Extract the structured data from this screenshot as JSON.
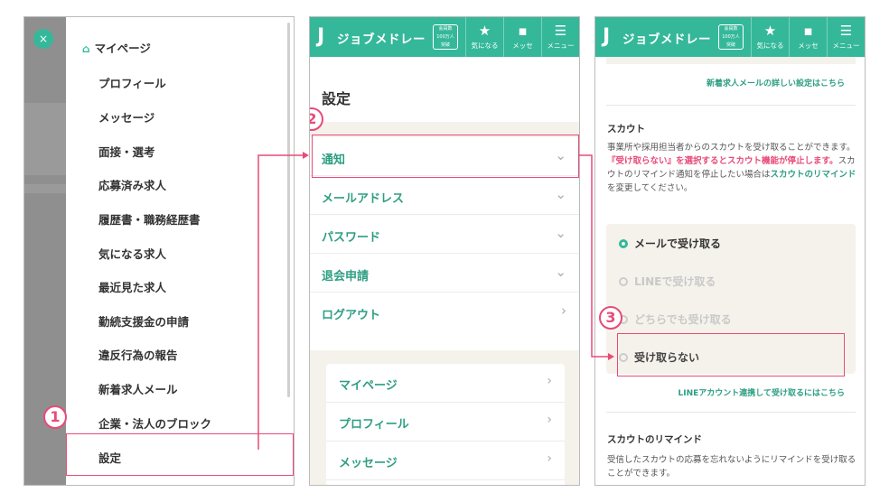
{
  "menu": {
    "close_symbol": "×",
    "home_label": "マイページ",
    "items": [
      "プロフィール",
      "メッセージ",
      "面接・選考",
      "応募済み求人",
      "履歴書・職務経歴書",
      "気になる求人",
      "最近見た求人",
      "勤続支援金の申請",
      "違反行為の報告",
      "新着求人メール",
      "企業・法人のブロック",
      "設定"
    ]
  },
  "header": {
    "logo_mark": "J",
    "logo_text": "ジョブメドレー",
    "member_badge": [
      "会員数",
      "100万人",
      "突破"
    ],
    "favorites_label": "気になる",
    "messages_label": "メッセ",
    "menu_label": "メニュー"
  },
  "settings": {
    "title": "設定",
    "items": [
      "通知",
      "メールアドレス",
      "パスワード",
      "退会申請",
      "ログアウト"
    ],
    "sub_items": [
      "マイページ",
      "プロフィール",
      "メッセージ"
    ]
  },
  "scout": {
    "new_job_mail_link": "新着求人メールの詳しい設定はこちら",
    "heading": "スカウト",
    "desc_part1": "事業所や採用担当者からのスカウトを受け取ることができます。",
    "desc_pink": "『受け取らない』を選択するとスカウト機能が停止します。",
    "desc_part2": "スカウトのリマインド通知を停止したい場合は",
    "desc_green": "スカウトのリマインド",
    "desc_part3": "を変更してください。",
    "options": [
      "メールで受け取る",
      "LINEで受け取る",
      "どちらでも受け取る",
      "受け取らない"
    ],
    "line_link": "LINEアカウント連携して受け取るにはこちら",
    "remind_heading": "スカウトのリマインド",
    "remind_desc": "受信したスカウトの応募を忘れないようにリマインドを受け取ることができます。"
  },
  "steps": [
    "1",
    "2",
    "3"
  ],
  "colors": {
    "brand": "#35b89a",
    "accent": "#e84a78",
    "link": "#2e9e83"
  }
}
